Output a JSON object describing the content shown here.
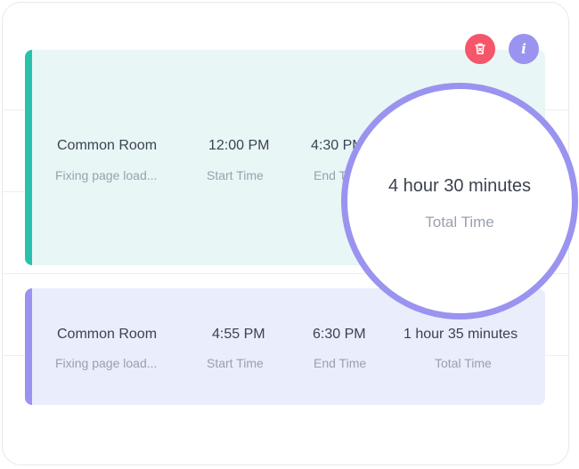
{
  "colors": {
    "card_1_accent": "#27c1ac",
    "card_2_accent": "#9a93ef",
    "delete_button": "#f5566a",
    "info_button": "#9a93ef",
    "magnifier_ring": "#9a93ef"
  },
  "actions": {
    "delete_icon": "trash-icon",
    "info_icon": "info-icon",
    "info_label": "i"
  },
  "entries": [
    {
      "room": "Common Room",
      "description": "Fixing page load...",
      "start_time": "12:00 PM",
      "start_label": "Start Time",
      "end_time": "4:30 PM",
      "end_label": "End Time"
    },
    {
      "room": "Common Room",
      "description": "Fixing page load...",
      "start_time": "4:55 PM",
      "start_label": "Start Time",
      "end_time": "6:30 PM",
      "end_label": "End Time",
      "total_time": "1 hour 35 minutes",
      "total_label": "Total Time"
    }
  ],
  "magnifier": {
    "total_time": "4 hour 30 minutes",
    "total_label": "Total Time"
  }
}
